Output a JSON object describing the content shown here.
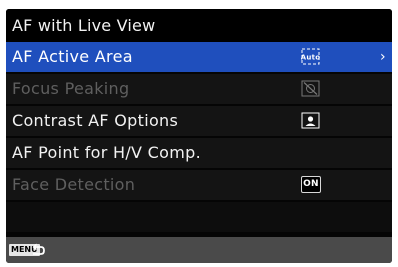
{
  "title": "AF with Live View",
  "items": [
    {
      "label": "AF Active Area",
      "icon": "auto-area-icon",
      "icon_text": "Auto",
      "state": "selected",
      "has_submenu": true
    },
    {
      "label": "Focus Peaking",
      "icon": "peaking-off-icon",
      "state": "disabled"
    },
    {
      "label": "Contrast AF Options",
      "icon": "face-frame-icon",
      "state": "normal"
    },
    {
      "label": "AF Point for H/V Comp.",
      "state": "normal"
    },
    {
      "label": "Face Detection",
      "icon": "on-badge",
      "icon_text": "ON",
      "state": "disabled"
    }
  ],
  "submenu_arrow": "›",
  "footer": {
    "menu_key": "MENU",
    "back_icon": "back-arrow-icon"
  },
  "colors": {
    "selected": "#1f4fbd",
    "row": "#141414",
    "disabled_text": "#5f5f5f",
    "footer": "#4a4a4a"
  }
}
